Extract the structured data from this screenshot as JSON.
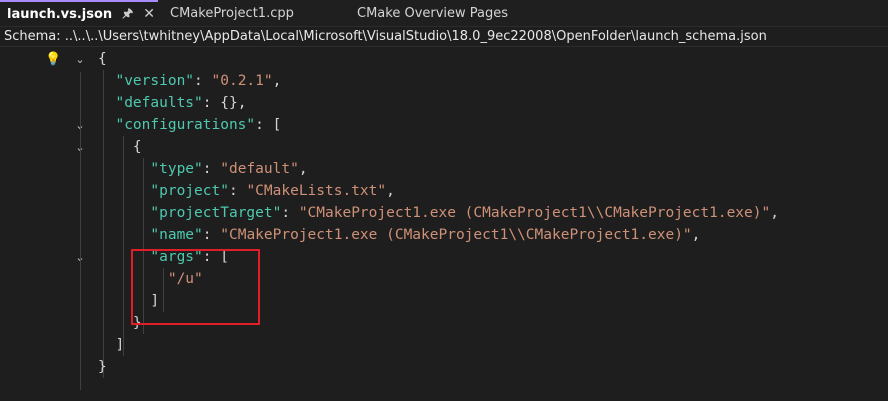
{
  "tabs": [
    {
      "label": "launch.vs.json",
      "active": true
    },
    {
      "label": "CMakeProject1.cpp",
      "active": false
    },
    {
      "label": "CMake Overview Pages",
      "active": false
    }
  ],
  "tab_icons": {
    "pin": "pin-icon",
    "close": "close-icon"
  },
  "schema_bar": {
    "text": "Schema: ..\\..\\..\\Users\\twhitney\\AppData\\Local\\Microsoft\\VisualStudio\\18.0_9ec22008\\OpenFolder\\launch_schema.json"
  },
  "code": {
    "open_brace": "{",
    "version_key": "\"version\"",
    "version_val": "\"0.2.1\"",
    "defaults_key": "\"defaults\"",
    "defaults_val": "{}",
    "configurations_key": "\"configurations\"",
    "obj_open": "{",
    "type_key": "\"type\"",
    "type_val": "\"default\"",
    "project_key": "\"project\"",
    "project_val": "\"CMakeLists.txt\"",
    "projectTarget_key": "\"projectTarget\"",
    "projectTarget_val": "\"CMakeProject1.exe (CMakeProject1\\\\CMakeProject1.exe)\"",
    "name_key": "\"name\"",
    "name_val": "\"CMakeProject1.exe (CMakeProject1\\\\CMakeProject1.exe)\"",
    "args_key": "\"args\"",
    "args_item": "\"/u\"",
    "args_close": "]",
    "obj_close": "}",
    "arr_close": "]",
    "close_brace": "}"
  },
  "colors": {
    "key": "#4ec9b0",
    "string": "#ce9178",
    "highlight": "#e01e28",
    "accent": "#a78bfa"
  }
}
